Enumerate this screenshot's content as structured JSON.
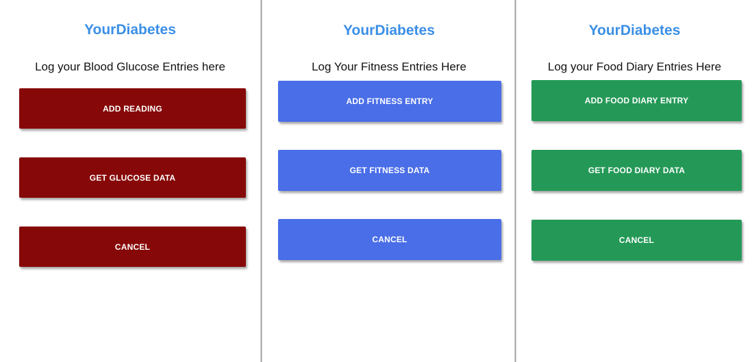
{
  "screens": [
    {
      "app_title": "YourDiabetes",
      "subtitle": "Log your Blood Glucose Entries here",
      "buttons": [
        "ADD READING",
        "GET GLUCOSE DATA",
        "CANCEL"
      ],
      "button_color": "#870808"
    },
    {
      "app_title": "YourDiabetes",
      "subtitle": "Log Your Fitness Entries Here",
      "buttons": [
        "ADD FITNESS ENTRY",
        "GET FITNESS DATA",
        "CANCEL"
      ],
      "button_color": "#4a6ee8"
    },
    {
      "app_title": "YourDiabetes",
      "subtitle": "Log your Food Diary Entries Here",
      "buttons": [
        "ADD FOOD DIARY ENTRY",
        "GET FOOD DIARY DATA",
        "CANCEL"
      ],
      "button_color": "#249957"
    }
  ],
  "colors": {
    "title": "#3a8fe6",
    "background": "#ffffff",
    "divider": "#9e9e9e"
  }
}
